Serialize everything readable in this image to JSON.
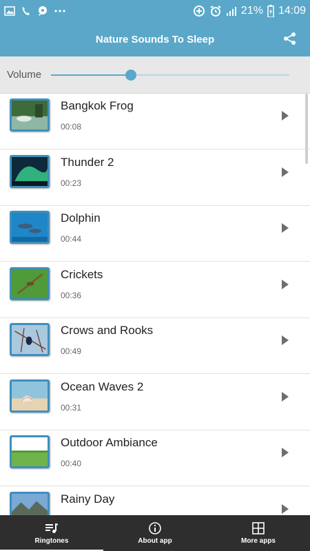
{
  "status_bar": {
    "battery_percent": "21%",
    "time": "14:09"
  },
  "header": {
    "title": "Nature Sounds To Sleep"
  },
  "volume": {
    "label": "Volume",
    "level_fraction": 0.335
  },
  "sounds": [
    {
      "title": "Bangkok Frog",
      "duration": "00:08"
    },
    {
      "title": "Thunder 2",
      "duration": "00:23"
    },
    {
      "title": "Dolphin",
      "duration": "00:44"
    },
    {
      "title": "Crickets",
      "duration": "00:36"
    },
    {
      "title": "Crows and Rooks",
      "duration": "00:49"
    },
    {
      "title": "Ocean Waves 2",
      "duration": "00:31"
    },
    {
      "title": "Outdoor Ambiance",
      "duration": "00:40"
    },
    {
      "title": "Rainy Day",
      "duration": ""
    }
  ],
  "bottom_nav": {
    "items": [
      {
        "label": "Ringtones",
        "icon": "music-list-icon",
        "active": true
      },
      {
        "label": "About app",
        "icon": "info-icon",
        "active": false
      },
      {
        "label": "More apps",
        "icon": "grid-icon",
        "active": false
      }
    ]
  },
  "colors": {
    "accent": "#5aa7c9",
    "nav_background": "#2e2e2e"
  }
}
